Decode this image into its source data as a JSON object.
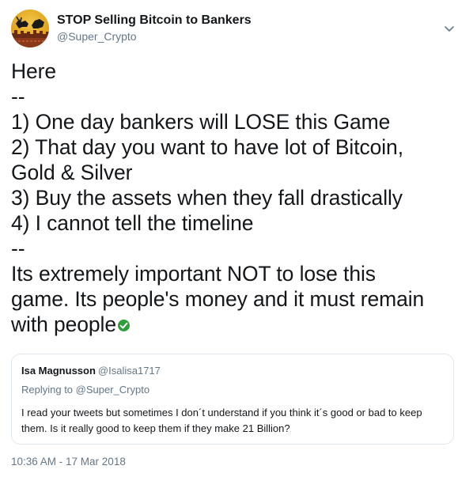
{
  "author": {
    "display_name": "STOP Selling Bitcoin to Bankers",
    "handle": "@Super_Crypto"
  },
  "tweet": {
    "lines": [
      "Here",
      "--",
      "1) One day bankers will LOSE this Game",
      "2) That day you want to have lot of Bitcoin,",
      "Gold & Silver",
      "3) Buy the assets when they fall drastically",
      "4) I cannot tell the timeline",
      "--",
      "Its extremely important NOT to lose this",
      "game. Its people's money and it must remain",
      "with people"
    ],
    "emoji_icon": "white-heavy-check-mark-icon",
    "timestamp": "10:36 AM - 17 Mar 2018"
  },
  "quoted_tweet": {
    "display_name": "Isa Magnusson",
    "handle": "@Isalisa1717",
    "replying_prefix": "Replying to",
    "replying_to": "@Super_Crypto",
    "text": "I read your tweets but sometimes I don´t understand if you think it´s good or bad to keep them. Is it really good to keep them if they make 21 Billion?"
  },
  "colors": {
    "text": "#14171a",
    "secondary": "#657786",
    "border": "#e1e8ed",
    "check_green": "#2e9e3a"
  }
}
